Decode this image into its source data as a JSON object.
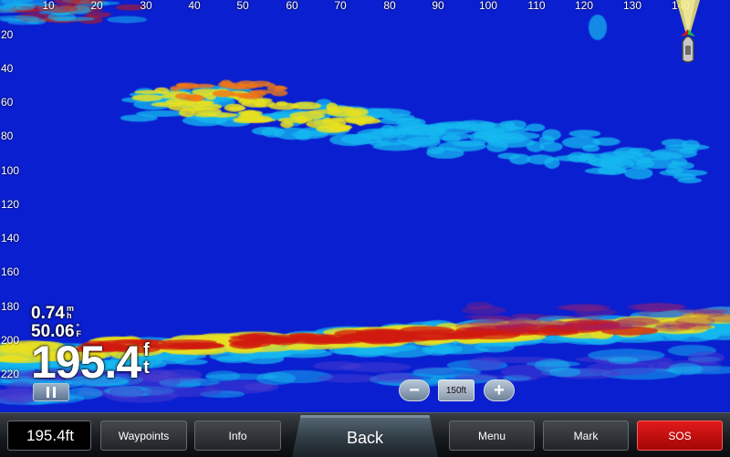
{
  "sonar": {
    "range_ticks": [
      "10",
      "20",
      "30",
      "40",
      "50",
      "60",
      "70",
      "80",
      "90",
      "100",
      "110",
      "120",
      "130",
      "140"
    ],
    "depth_ticks": [
      "20",
      "40",
      "60",
      "80",
      "100",
      "120",
      "140",
      "160",
      "180",
      "200",
      "220"
    ],
    "palette": {
      "water": "#0a1fd0",
      "mid": "#15b8f0",
      "high": "#e8e020",
      "peak": "#d01a10"
    }
  },
  "readouts": {
    "speed_value": "0.74",
    "speed_unit_top": "m",
    "speed_unit_bottom": "h",
    "temp_value": "50.06",
    "temp_unit_top": "°",
    "temp_unit_bottom": "F",
    "depth_value": "195.4",
    "depth_unit_top": "f",
    "depth_unit_bottom": "t"
  },
  "controls": {
    "zoom_minus": "−",
    "zoom_plus": "+",
    "range_label": "150ft"
  },
  "toolbar": {
    "depth_value": "195.4ft",
    "waypoints_label": "Waypoints",
    "info_label": "Info",
    "back_label": "Back",
    "menu_label": "Menu",
    "mark_label": "Mark",
    "sos_label": "SOS"
  }
}
